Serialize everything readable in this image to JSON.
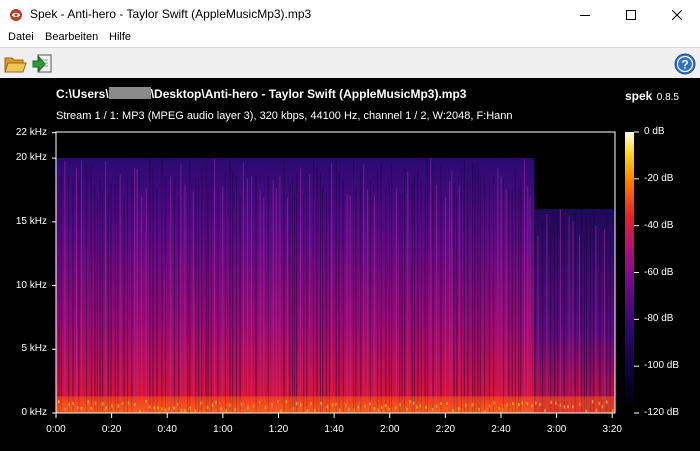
{
  "window": {
    "title": "Spek - Anti-hero - Taylor Swift (AppleMusicMp3).mp3",
    "controls": [
      "minimize",
      "maximize",
      "close"
    ]
  },
  "menu": {
    "file": "Datei",
    "edit": "Bearbeiten",
    "help": "Hilfe"
  },
  "toolbar": {
    "open_icon": "folder-open-icon",
    "save_icon": "save-export-icon",
    "help_icon": "help-icon"
  },
  "spectrogram": {
    "path_prefix": "C:\\Users\\",
    "path_suffix": "\\Desktop\\Anti-hero - Taylor Swift (AppleMusicMp3).mp3",
    "app_name": "spek",
    "app_version": "0.8.5",
    "stream_info": "Stream 1 / 1: MP3 (MPEG audio layer 3), 320 kbps, 44100 Hz, channel 1 / 2, W:2048, F:Hann"
  },
  "chart_data": {
    "type": "heatmap",
    "x_tick_labels": [
      "0:00",
      "0:20",
      "0:40",
      "1:00",
      "1:20",
      "1:40",
      "2:00",
      "2:20",
      "2:40",
      "3:00",
      "3:20"
    ],
    "x_ticks_seconds": [
      0,
      20,
      40,
      60,
      80,
      100,
      120,
      140,
      160,
      180,
      200
    ],
    "x_range_seconds": [
      0,
      201
    ],
    "y_tick_labels": [
      "0 kHz",
      "5 kHz",
      "10 kHz",
      "15 kHz",
      "20 kHz",
      "22 kHz"
    ],
    "y_ticks_khz": [
      0,
      5,
      10,
      15,
      20,
      22
    ],
    "y_range_khz": [
      0,
      22.05
    ],
    "colorbar_labels": [
      "0 dB",
      "-20 dB",
      "-40 dB",
      "-60 dB",
      "-80 dB",
      "-100 dB",
      "-120 dB"
    ],
    "colorbar_db": [
      0,
      -20,
      -40,
      -60,
      -80,
      -100,
      -120
    ],
    "content_cutoff_khz": 20,
    "outro_start_seconds": 172,
    "outro_cutoff_khz": 16
  }
}
